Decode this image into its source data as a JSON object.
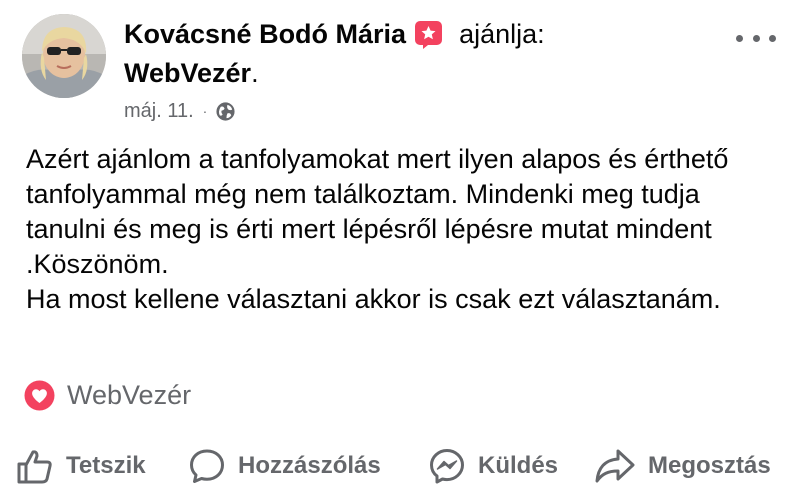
{
  "post": {
    "author": "Kovácsné Bodó Mária",
    "recommend_text": "ajánlja:",
    "page_name": "WebVezér",
    "period": ".",
    "date": "máj. 11.",
    "separator": "·",
    "audience_icon": "globe-icon",
    "badge_icon": "recommendation-badge-icon",
    "paragraphs": [
      "Azért ajánlom a tanfolyamokat mert ilyen alapos és érthető tanfolyammal még nem találkoztam. Mindenki meg tudja tanulni és meg is érti mert lépésről lépésre mutat mindent .Köszönöm.",
      "Ha most kellene választani akkor is csak ezt választanám."
    ],
    "tag_label": "WebVezér",
    "tag_icon": "heart-badge-icon"
  },
  "actions": {
    "like": "Tetszik",
    "comment": "Hozzászólás",
    "send": "Küldés",
    "share": "Megosztás"
  },
  "colors": {
    "text": "#050505",
    "secondary": "#65676b",
    "recommend_red": "#f3425f",
    "background": "#ffffff"
  }
}
